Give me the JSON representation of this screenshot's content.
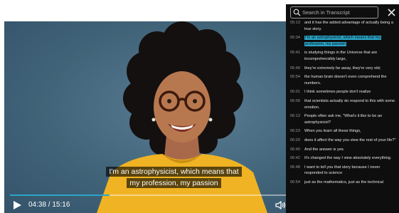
{
  "player": {
    "caption_line1": "I'm an astrophysicist, which means that",
    "caption_line2": "my profession, my passion",
    "current_time": "04:38",
    "duration": "15:16",
    "time_display": "04:38 / 15:16",
    "progress": 0.303,
    "colors": {
      "accent": "#2aa6c9",
      "background": "#3c5e76",
      "shirt": "#f0b323"
    },
    "icons": [
      "play-icon",
      "volume-icon",
      "language-icon",
      "settings-icon",
      "fullscreen-icon"
    ]
  },
  "transcript": {
    "search_placeholder": "Search in Transcript",
    "close_icon": "close-icon",
    "entries": [
      {
        "time": "05:13",
        "text": "and it has the added advantage of actually being a true story."
      },
      {
        "time": "05:34",
        "text": "I'm an astrophysicist, which means that my profession, my passion",
        "active": true
      },
      {
        "time": "05:41",
        "text": "is studying things in the Universe that are incomprehensibly large,"
      },
      {
        "time": "05:49",
        "text": "they're extremely far away, they're very old;"
      },
      {
        "time": "05:54",
        "text": "the human brain doesn't even comprehend the numbers."
      },
      {
        "time": "06:01",
        "text": "I think sometimes people don't realize"
      },
      {
        "time": "06:09",
        "text": "that scientists actually do respond to this with some emotion."
      },
      {
        "time": "06:13",
        "text": "People often ask me, \"What's it like to be an astrophysicist?"
      },
      {
        "time": "06:23",
        "text": "When you learn all these things,"
      },
      {
        "time": "06:20",
        "text": "does it affect the way you view the rest of your life?\""
      },
      {
        "time": "06:40",
        "text": "And the answer is yes."
      },
      {
        "time": "06:42",
        "text": "It's changed the way I view absolutely everything."
      },
      {
        "time": "06:48",
        "text": "I want to tell you that story because I never responded to science"
      },
      {
        "time": "06:54",
        "text": "just as the mathematics, just as the technical"
      }
    ]
  }
}
